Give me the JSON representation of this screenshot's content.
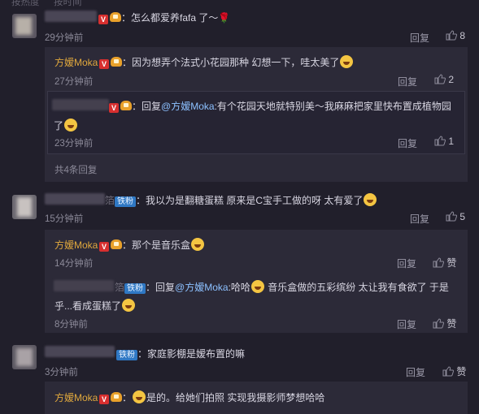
{
  "top_tabs": [
    "按热度",
    "按时间"
  ],
  "comments": [
    {
      "text": "：怎么都爱养fafa 了～",
      "time": "29分钟前",
      "reply": "回复",
      "likes": "8",
      "sub": [
        {
          "user": "方嫒Moka",
          "text": "：因为想弄个法式小花园那种 幻想一下，哇太美了",
          "time": "27分钟前",
          "reply": "回复",
          "likes": "2"
        },
        {
          "text_a": "：回复",
          "mention": "@方嫒Moka",
          "text_b": ":有个花园天地就特别美～我麻麻把家里快布置成植物园",
          "text_c": "了",
          "time": "23分钟前",
          "reply": "回复",
          "likes": "1"
        }
      ],
      "more": "共4条回复"
    },
    {
      "name_tail": "箔",
      "fan": "铁粉",
      "text": "：我以为是翻糖蛋糕 原来是C宝手工做的呀 太有爱了",
      "time": "15分钟前",
      "reply": "回复",
      "likes": "5",
      "sub": [
        {
          "user": "方嫒Moka",
          "text": "：那个是音乐盒",
          "time": "14分钟前",
          "reply": "回复",
          "likes": "赞"
        },
        {
          "name_tail": "箔",
          "fan": "铁粉",
          "text_a": "：回复",
          "mention": "@方嫒Moka",
          "text_b": ":哈哈",
          "text_c": " 音乐盒做的五彩缤纷 太让我有食欲了 于是",
          "text_d": "乎...看成蛋糕了",
          "time": "8分钟前",
          "reply": "回复",
          "likes": "赞"
        }
      ]
    },
    {
      "fan": "铁粉",
      "text": "：家庭影棚是嫒布置的嘛",
      "time": "3分钟前",
      "reply": "回复",
      "likes": "赞",
      "sub": [
        {
          "user": "方嫒Moka",
          "text_b": "是的。给她们拍照 实现我摄影师梦想哈哈"
        }
      ]
    }
  ],
  "colors": {
    "bg": "#211f2b",
    "panel": "#2c2a38",
    "username": "#e0a83d",
    "mention": "#8cc0ff",
    "fan_badge": "#2f78c4",
    "v_badge": "#d72f2f"
  }
}
